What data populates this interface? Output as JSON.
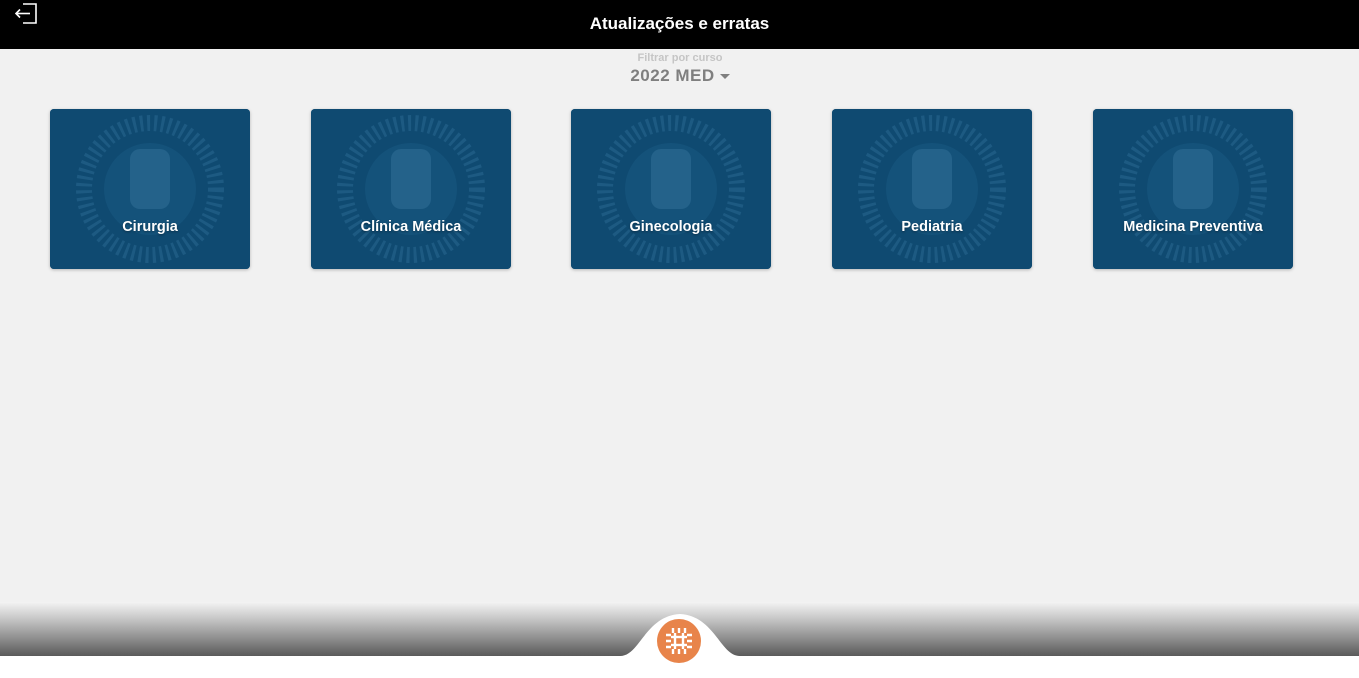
{
  "header": {
    "title": "Atualizações e erratas",
    "exit_icon": "exit-arrow-icon"
  },
  "filter": {
    "label": "Filtrar por curso",
    "selected": "2022 MED"
  },
  "cards": [
    {
      "label": "Cirurgia"
    },
    {
      "label": "Clínica Médica"
    },
    {
      "label": "Ginecologia"
    },
    {
      "label": "Pediatria"
    },
    {
      "label": "Medicina Preventiva"
    }
  ],
  "colors": {
    "header_bg": "#000000",
    "page_bg": "#f1f1f1",
    "card_bg": "#0f4a71",
    "logo_orange": "#e8844a"
  },
  "footer": {
    "logo_icon": "medical-cross-logo-icon"
  }
}
